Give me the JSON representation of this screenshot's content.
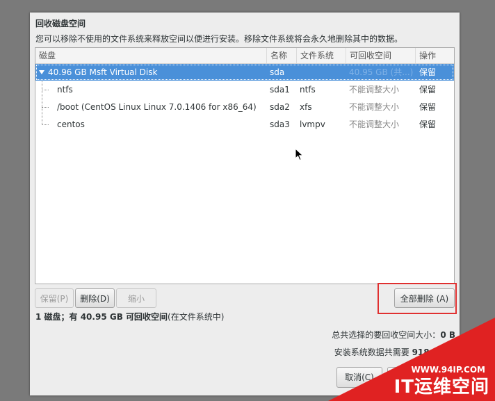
{
  "dialog": {
    "title": "回收磁盘空间",
    "description": "您可以移除不使用的文件系统来释放空间以便进行安装。移除文件系统将会永久地删除其中的数据。"
  },
  "table": {
    "headers": {
      "disk": "磁盘",
      "name": "名称",
      "filesystem": "文件系统",
      "reclaimable": "可回收空间",
      "action": "操作"
    },
    "rows": [
      {
        "disk": "40.96 GB Msft Virtual Disk",
        "name": "sda",
        "filesystem": "",
        "reclaimable": "40.95 GB (共...)",
        "action": "保留"
      },
      {
        "disk": "ntfs",
        "name": "sda1",
        "filesystem": "ntfs",
        "reclaimable": "不能调整大小",
        "action": "保留"
      },
      {
        "disk": "/boot (CentOS Linux Linux 7.0.1406 for x86_64)",
        "name": "sda2",
        "filesystem": "xfs",
        "reclaimable": "不能调整大小",
        "action": "保留"
      },
      {
        "disk": "centos",
        "name": "sda3",
        "filesystem": "lvmpv",
        "reclaimable": "不能调整大小",
        "action": "保留"
      }
    ]
  },
  "buttons": {
    "preserve": "保留(P)",
    "delete": "删除(D)",
    "shrink": "缩小 (S)",
    "delete_all": "全部删除 (A)",
    "cancel": "取消(C)"
  },
  "summary": {
    "prefix": "1 磁盘；有 40.95 GB 可回收空间",
    "suffix": "(在文件系统中)"
  },
  "info": {
    "selected_label": "总共选择的要回收空间大小：",
    "selected_value": "0 B",
    "required_label": "安装系统数据共需要 ",
    "required_value": "918.46 M"
  },
  "watermark": {
    "url": "WWW.94IP.COM",
    "logo": "IT运维空间"
  },
  "colors": {
    "selection": "#4a90d9",
    "highlight_box": "#e03030",
    "watermark": "#e02222"
  }
}
